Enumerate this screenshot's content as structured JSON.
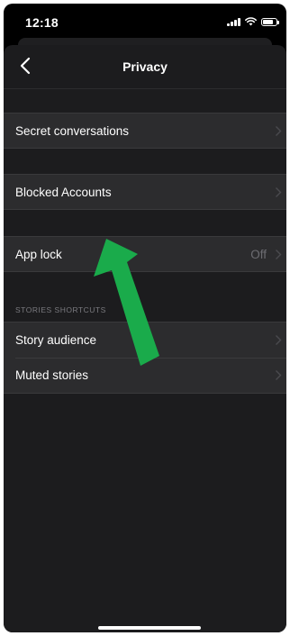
{
  "status_bar": {
    "time": "12:18",
    "icons": [
      "signal-icon",
      "wifi-icon",
      "battery-icon"
    ]
  },
  "nav": {
    "title": "Privacy",
    "back_icon": "chevron-left-icon"
  },
  "rows": {
    "secret_conversations": {
      "label": "Secret conversations"
    },
    "blocked_accounts": {
      "label": "Blocked Accounts"
    },
    "app_lock": {
      "label": "App lock",
      "value": "Off"
    }
  },
  "stories_section": {
    "header": "STORIES SHORTCUTS",
    "items": [
      {
        "label": "Story audience"
      },
      {
        "label": "Muted stories"
      }
    ]
  },
  "annotation": {
    "type": "arrow",
    "color": "#1aab4b",
    "points_to": "app_lock"
  },
  "colors": {
    "background": "#000000",
    "cell": "#2c2c2e",
    "sheet": "#1c1c1e",
    "secondary_text": "#6d6d72"
  }
}
